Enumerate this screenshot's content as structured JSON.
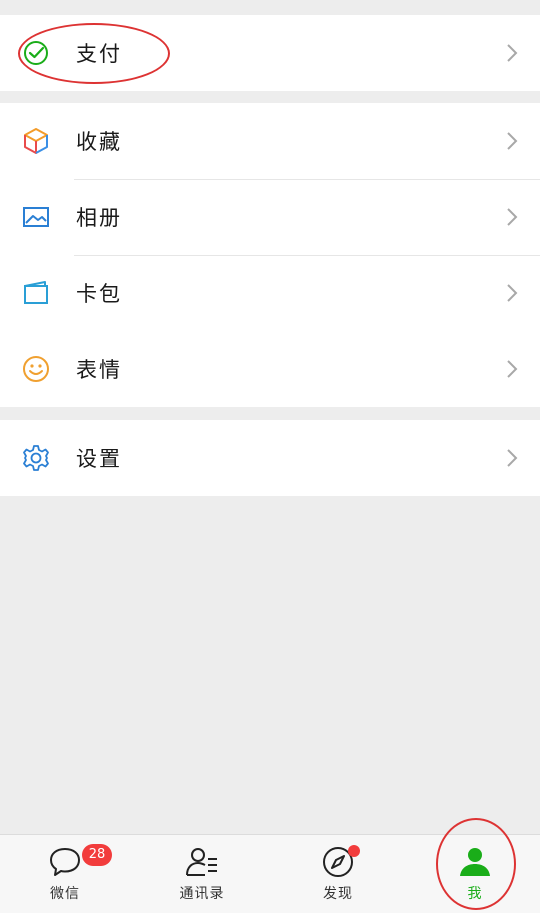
{
  "sections": {
    "pay": {
      "label": "支付"
    },
    "items": [
      {
        "label": "收藏"
      },
      {
        "label": "相册"
      },
      {
        "label": "卡包"
      },
      {
        "label": "表情"
      }
    ],
    "settings": {
      "label": "设置"
    }
  },
  "tabbar": {
    "tabs": [
      {
        "label": "微信",
        "badge": "28"
      },
      {
        "label": "通讯录"
      },
      {
        "label": "发现"
      },
      {
        "label": "我"
      }
    ]
  },
  "colors": {
    "accent": "#1aad19",
    "badge": "#f23c3c",
    "annotation": "#d33333"
  }
}
